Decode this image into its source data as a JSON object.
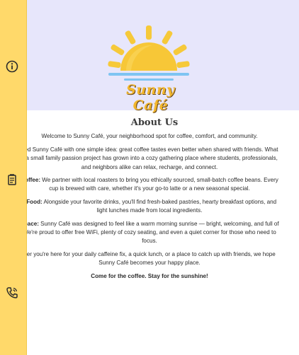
{
  "brand": {
    "name": "Sunny Café",
    "colors": {
      "sun": "#f6c93a",
      "sun_shadow": "#f1b72e",
      "sea": "#7ec4f2",
      "hero_bg": "#e7e6fb",
      "sidebar_bg": "#ffd96a"
    }
  },
  "sidebar": {
    "icons": [
      "info-icon",
      "menu-icon",
      "phone-icon"
    ]
  },
  "about": {
    "title": "About Us",
    "intro": "Welcome to Sunny Café, your neighborhood spot for coffee, comfort, and community.",
    "story": [
      "rted Sunny Café with one simple idea: great coffee tastes even better when shared with friends. What",
      "s a small family passion project has grown into a cozy gathering place where students, professionals,",
      "and neighbors alike can relax, recharge, and connect."
    ],
    "coffee_label": "Coffee:",
    "coffee": [
      " We partner with local roasters to bring you ethically sourced, small-batch coffee beans. Every",
      "cup is brewed with care, whether it's your go-to latte or a new seasonal special."
    ],
    "food_label": "r Food:",
    "food": [
      " Alongside your favorite drinks, you'll find fresh-baked pastries, hearty breakfast options, and",
      "light lunches made from local ingredients."
    ],
    "space_label": "Space:",
    "space": [
      " Sunny Café was designed to feel like a warm morning sunrise — bright, welcoming, and full of",
      "We're proud to offer free WiFi, plenty of cozy seating, and even a quiet corner for those who need to",
      "focus."
    ],
    "outro": [
      "her you're here for your daily caffeine fix, a quick lunch, or a place to catch up with friends, we hope",
      "Sunny Café becomes your happy place."
    ],
    "closing": "Come for the coffee. Stay for the sunshine!"
  }
}
